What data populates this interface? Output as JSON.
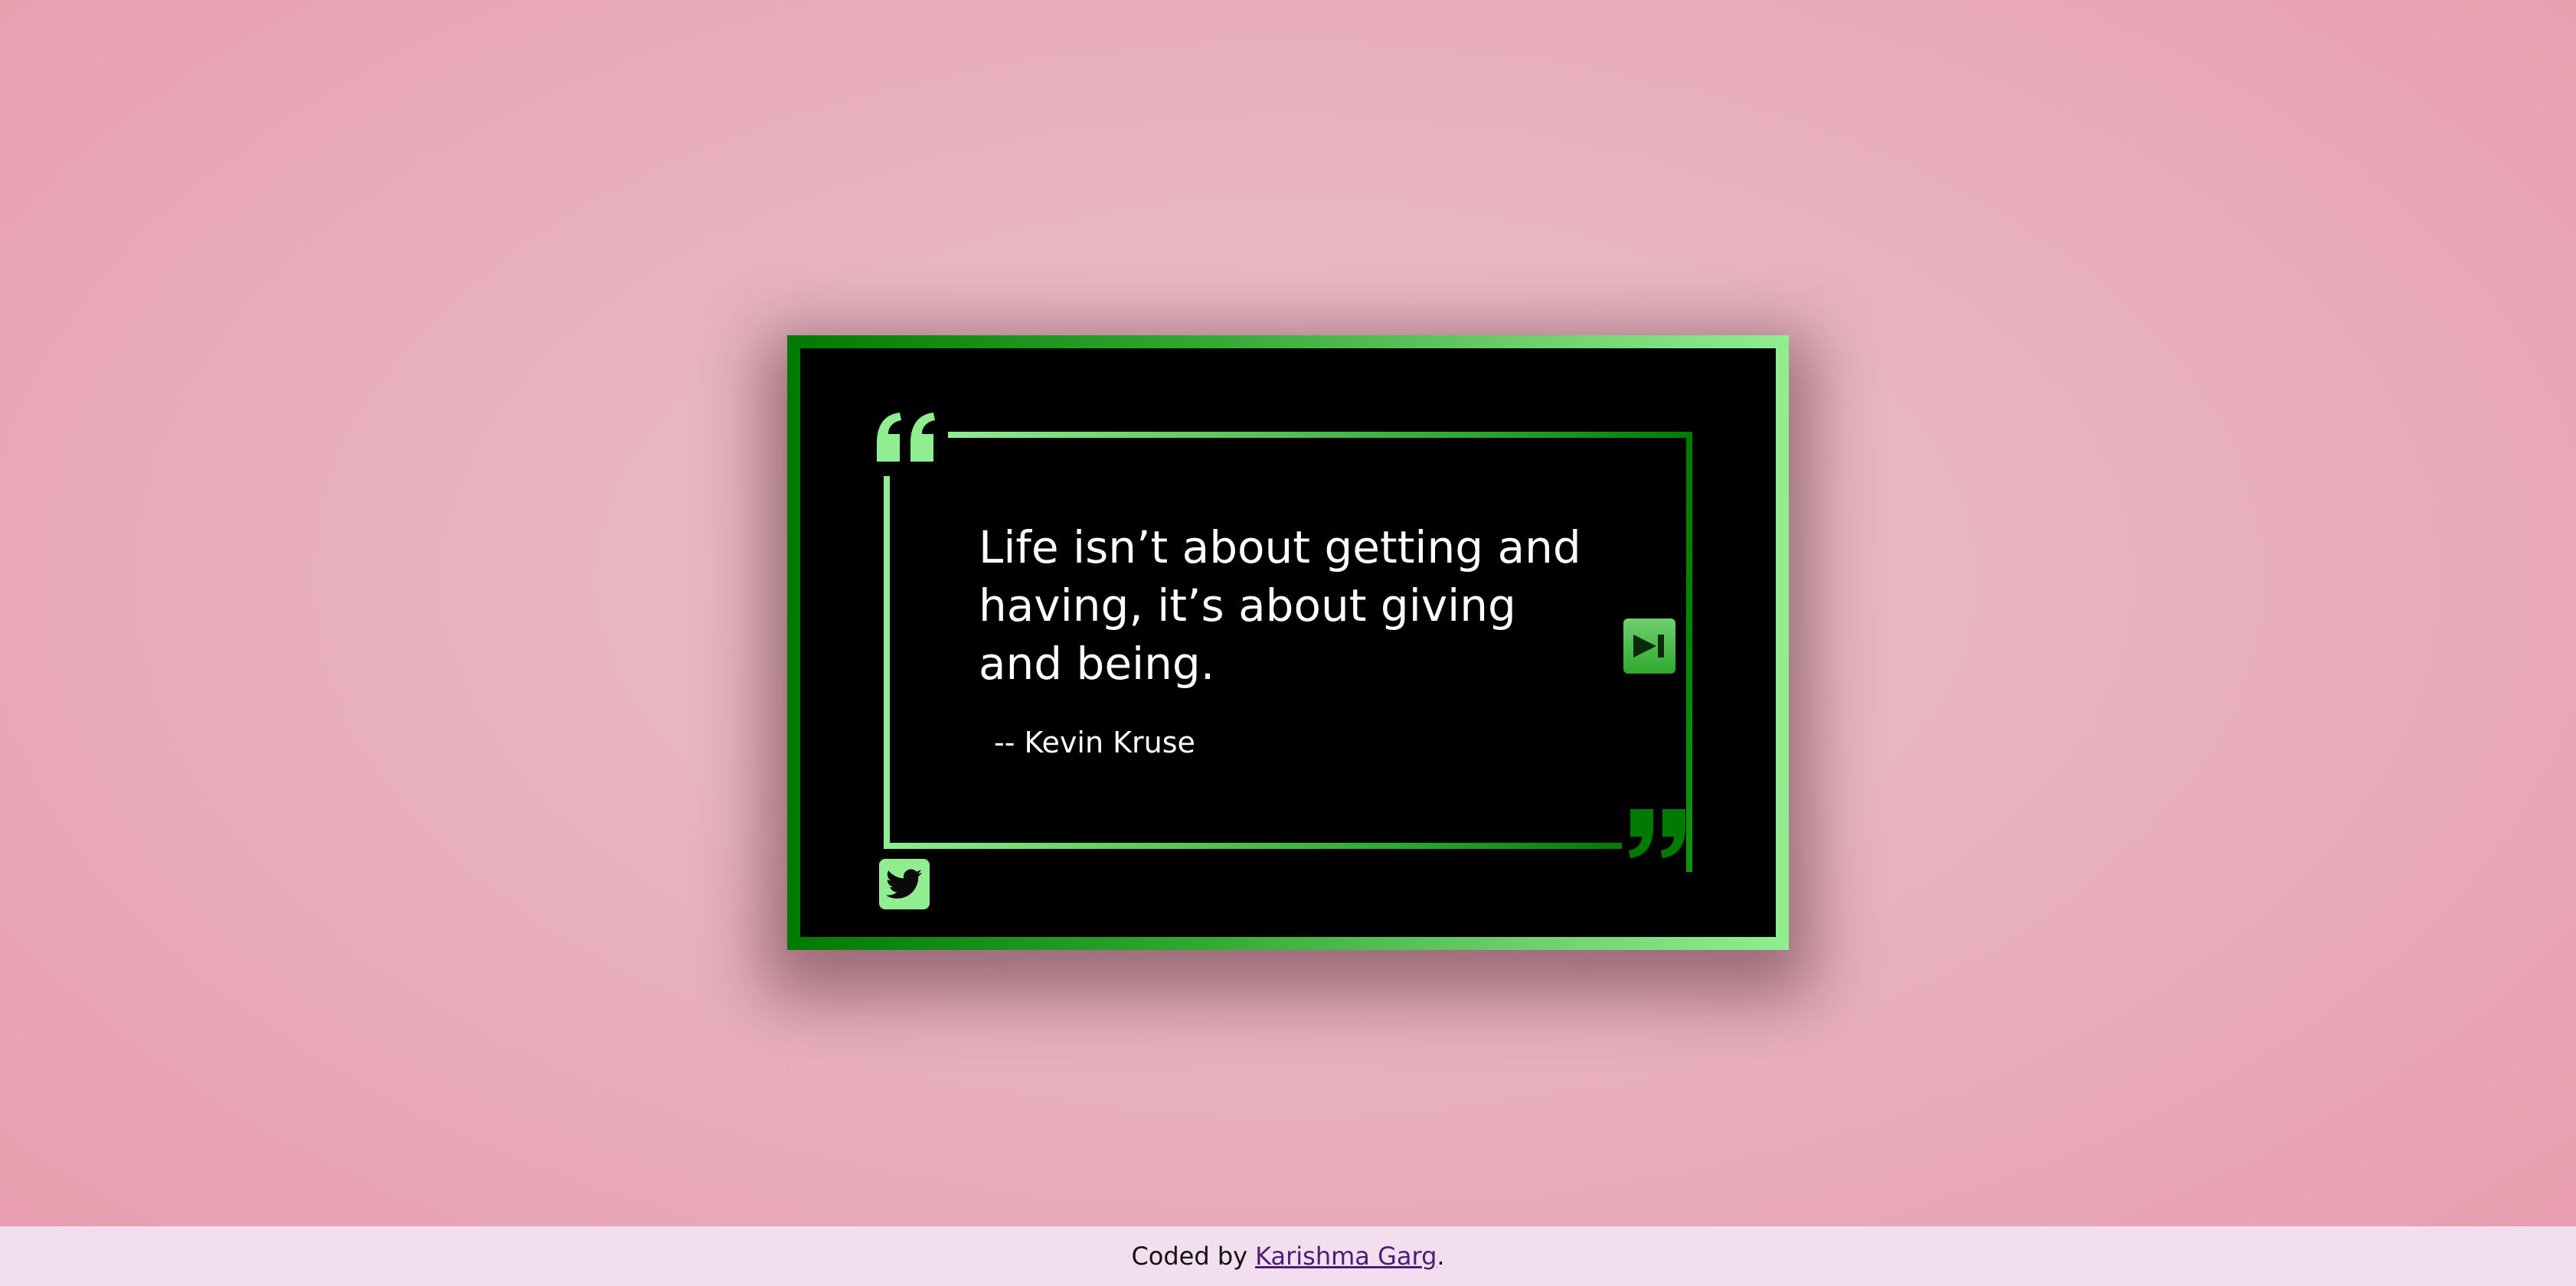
{
  "quote": {
    "text": "Life isn’t about getting and having, it’s about giving and being.",
    "author": "-- Kevin Kruse"
  },
  "icons": {
    "open_quote": "quote-left-icon",
    "close_quote": "quote-right-icon",
    "next": "skip-forward-icon",
    "twitter": "twitter-icon"
  },
  "footer": {
    "prefix": "Coded by",
    "author_link": "Karishma Garg ",
    "suffix": "."
  },
  "colors": {
    "accent_light": "#90ee90",
    "accent_dark": "#007a00",
    "card_bg": "#000000",
    "footer_bg": "#f3deef",
    "link": "#4b1e73"
  }
}
